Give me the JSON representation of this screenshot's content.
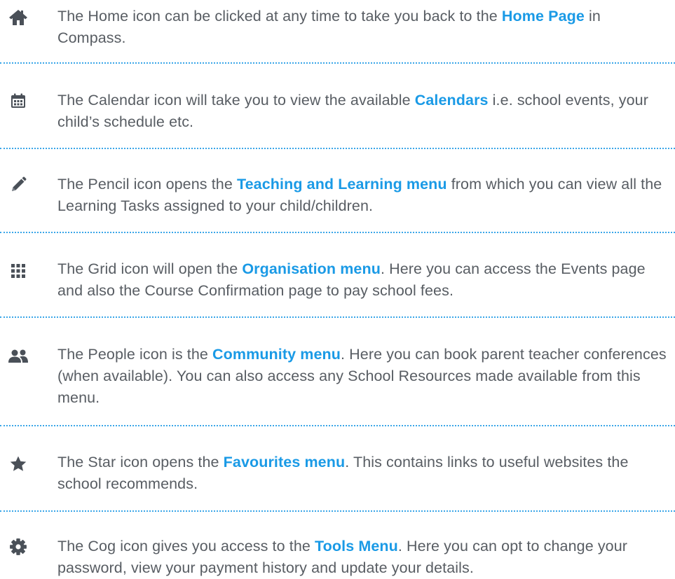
{
  "items": [
    {
      "icon": "home-icon",
      "pre": "The Home icon can be clicked at any time to take you back to the ",
      "link": "Home Page",
      "post": " in Compass."
    },
    {
      "icon": "calendar-icon",
      "pre": "The Calendar icon will take you to view the available ",
      "link": "Calendars",
      "post": " i.e. school events, your child’s schedule etc."
    },
    {
      "icon": "pencil-icon",
      "pre": "The Pencil icon opens the ",
      "link": "Teaching and Learning menu",
      "post": " from which you can view all the Learning Tasks assigned to your child/children."
    },
    {
      "icon": "grid-icon",
      "pre": "The Grid icon will open the ",
      "link": "Organisation menu",
      "post": ". Here you can access the Events page and also the Course Confirmation page to pay school fees."
    },
    {
      "icon": "people-icon",
      "pre": "The People icon is the ",
      "link": "Community menu",
      "post": ". Here you can book parent teacher conferences (when available). You can also access any School Resources made available from this menu."
    },
    {
      "icon": "star-icon",
      "pre": "The Star icon opens the ",
      "link": "Favourites menu",
      "post": ". This contains links to useful websites the school recommends."
    },
    {
      "icon": "cog-icon",
      "pre": "The Cog icon gives you access to the ",
      "link": "Tools Menu",
      "post": ". Here you can opt to change your password, view your payment history and update your details."
    }
  ],
  "colors": {
    "text": "#585d63",
    "link": "#1a9ae6",
    "icon": "#4a5058",
    "divider": "#3aa6e8"
  }
}
